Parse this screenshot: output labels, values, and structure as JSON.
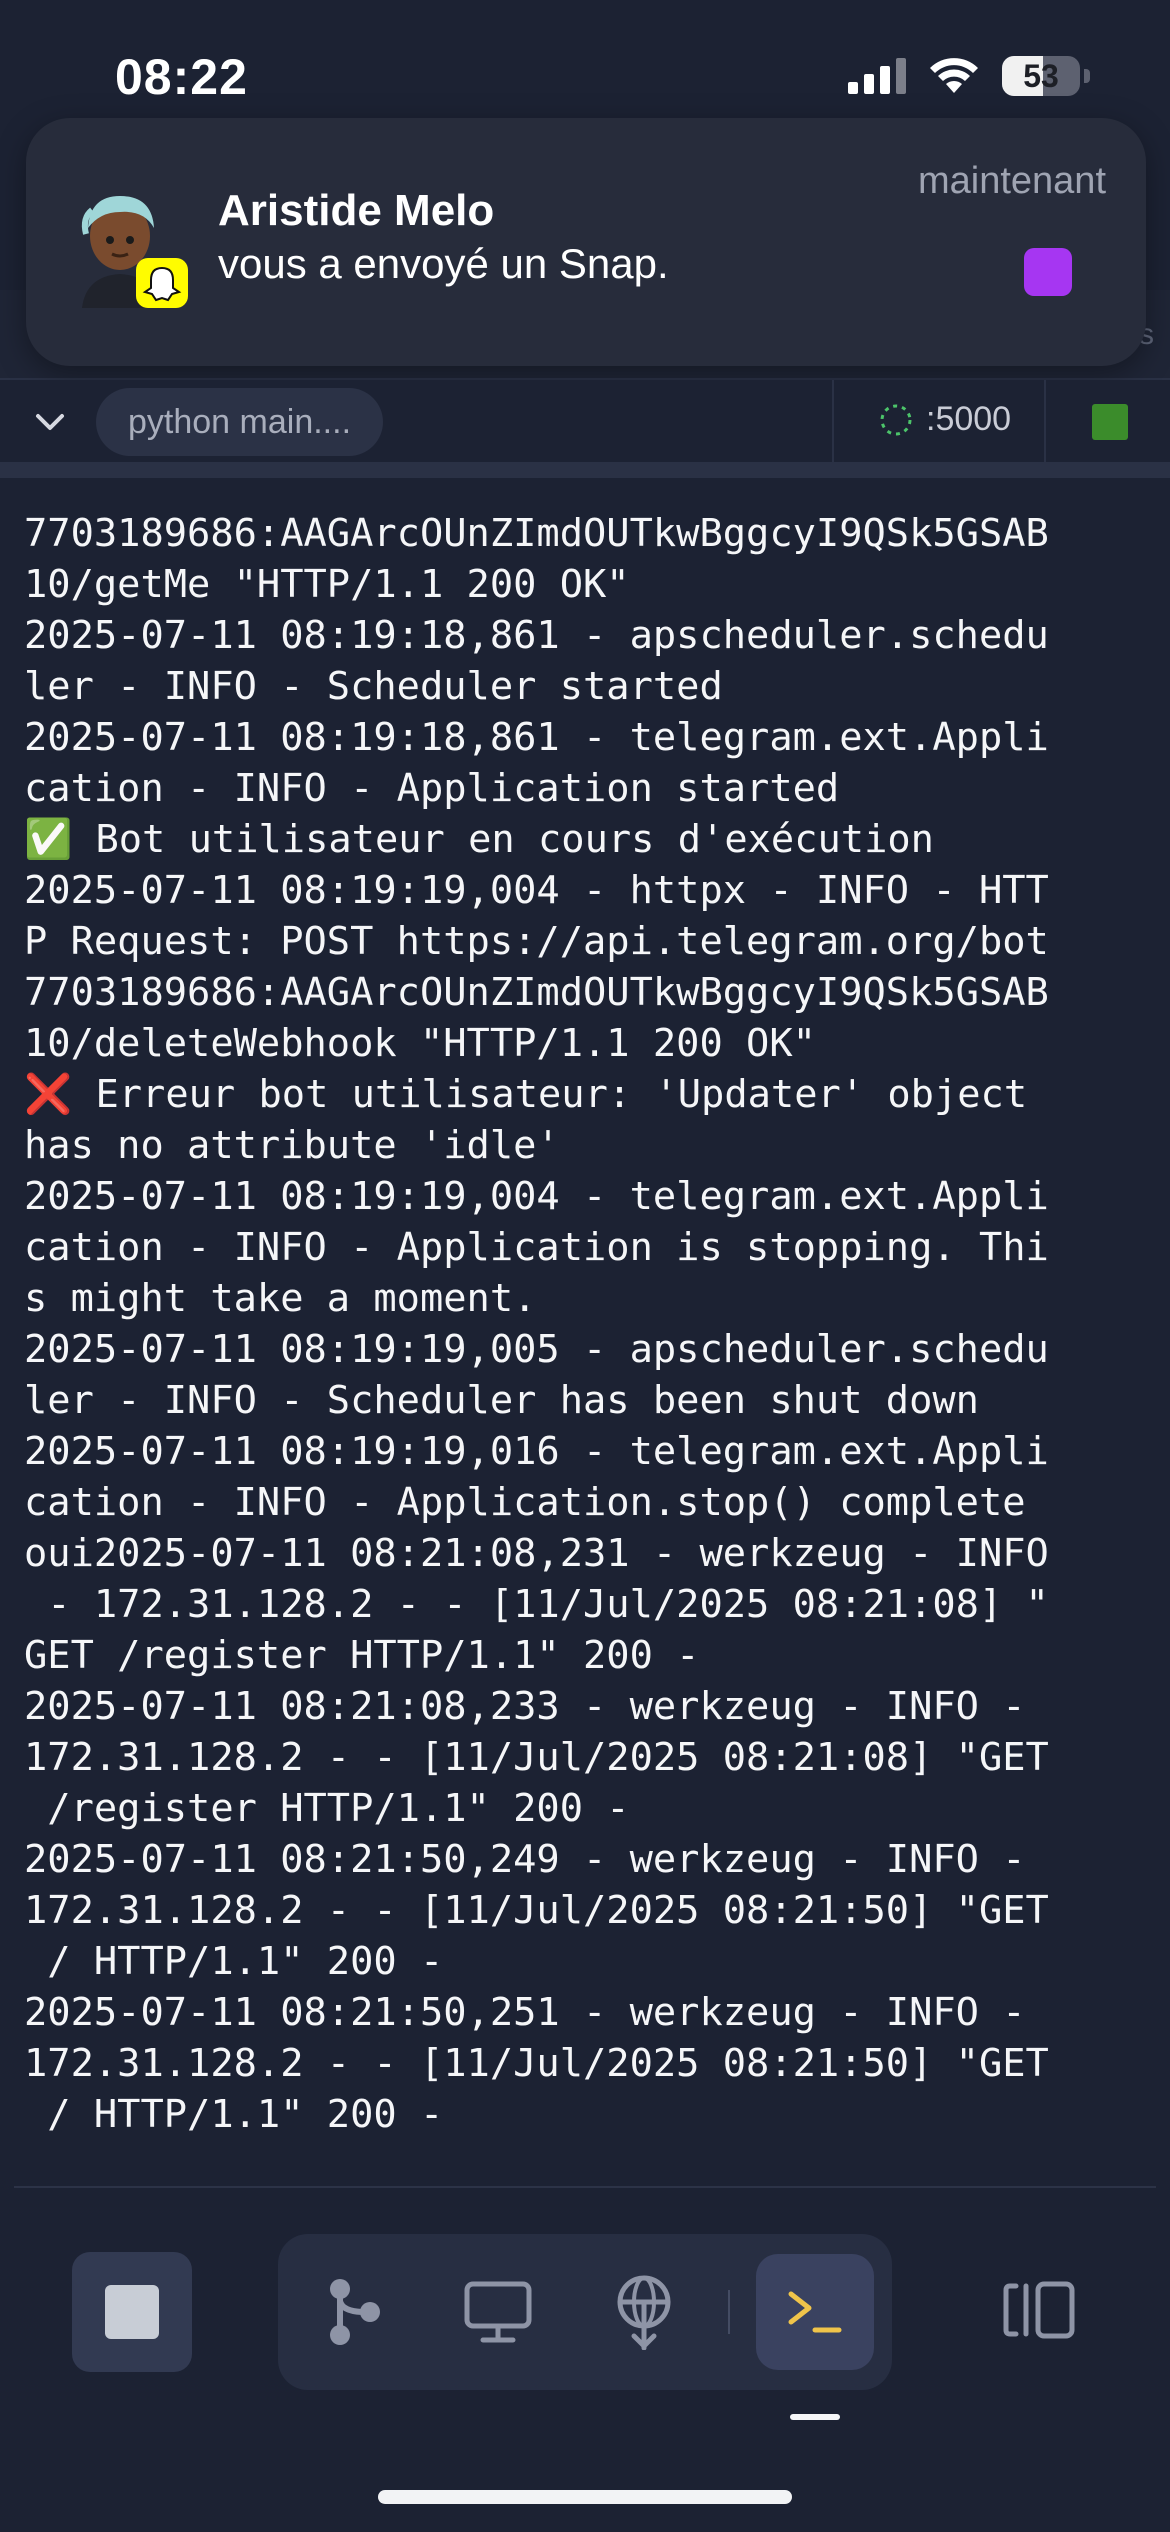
{
  "status_bar": {
    "time": "08:22",
    "battery": "53",
    "battery_level": 0.53
  },
  "notification": {
    "sender": "Aristide Melo",
    "message": "vous a envoyé un Snap.",
    "time": "maintenant",
    "app_icon": "snapchat-ghost-icon",
    "snap_color": "#a636f2"
  },
  "tab_bar": {
    "command": "python main....",
    "port": ":5000",
    "ghost_label": "is",
    "run_color": "#3b8c2b"
  },
  "console": {
    "lines": [
      "7703189686:AAGArcOUnZImdOUTkwBggcyI9QSk5GSAB",
      "10/getMe \"HTTP/1.1 200 OK\"",
      "2025-07-11 08:19:18,861 - apscheduler.schedu",
      "ler - INFO - Scheduler started",
      "2025-07-11 08:19:18,861 - telegram.ext.Appli",
      "cation - INFO - Application started",
      "✅ Bot utilisateur en cours d'exécution",
      "2025-07-11 08:19:19,004 - httpx - INFO - HTT",
      "P Request: POST https://api.telegram.org/bot",
      "7703189686:AAGArcOUnZImdOUTkwBggcyI9QSk5GSAB",
      "10/deleteWebhook \"HTTP/1.1 200 OK\"",
      "❌ Erreur bot utilisateur: 'Updater' object",
      "has no attribute 'idle'",
      "2025-07-11 08:19:19,004 - telegram.ext.Appli",
      "cation - INFO - Application is stopping. Thi",
      "s might take a moment.",
      "2025-07-11 08:19:19,005 - apscheduler.schedu",
      "ler - INFO - Scheduler has been shut down",
      "2025-07-11 08:19:19,016 - telegram.ext.Appli",
      "cation - INFO - Application.stop() complete",
      "oui2025-07-11 08:21:08,231 - werkzeug - INFO",
      " - 172.31.128.2 - - [11/Jul/2025 08:21:08] \"",
      "GET /register HTTP/1.1\" 200 -",
      "2025-07-11 08:21:08,233 - werkzeug - INFO -",
      "172.31.128.2 - - [11/Jul/2025 08:21:08] \"GET",
      " /register HTTP/1.1\" 200 -",
      "2025-07-11 08:21:50,249 - werkzeug - INFO -",
      "172.31.128.2 - - [11/Jul/2025 08:21:50] \"GET",
      " / HTTP/1.1\" 200 -",
      "2025-07-11 08:21:50,251 - werkzeug - INFO -",
      "172.31.128.2 - - [11/Jul/2025 08:21:50] \"GET",
      " / HTTP/1.1\" 200 -"
    ]
  },
  "bottom_bar": {
    "tools": [
      "git-branch-icon",
      "monitor-icon",
      "network-globe-icon",
      "terminal-icon"
    ],
    "active_tool": "terminal-icon",
    "accent": "#f0c44a"
  }
}
